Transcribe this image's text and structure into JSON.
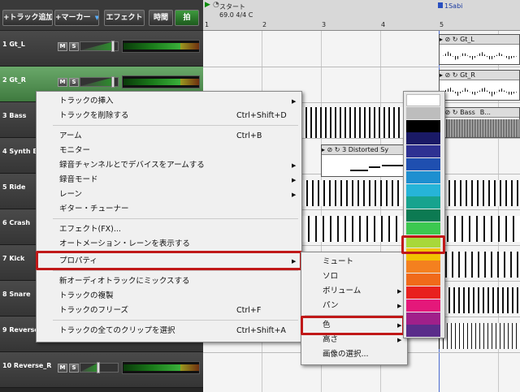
{
  "toolbar": {
    "add_track": "+トラック追加",
    "marker": "+マーカー",
    "effect": "エフェクト",
    "time": "時間",
    "beat": "拍"
  },
  "ruler": {
    "start_marker": "スタート",
    "tempo": "69.0 4/4 C",
    "sabi_marker": "1Sabi",
    "bars": [
      "1",
      "2",
      "3",
      "4",
      "5"
    ]
  },
  "tracks": [
    {
      "name": "1 Gt_L",
      "mute": "M",
      "solo": "S"
    },
    {
      "name": "2 Gt_R",
      "mute": "M",
      "solo": "S"
    },
    {
      "name": "3 Bass"
    },
    {
      "name": "4 Synth B"
    },
    {
      "name": "5 Ride"
    },
    {
      "name": "6 Crash"
    },
    {
      "name": "7 Kick"
    },
    {
      "name": "8 Snare"
    },
    {
      "name": "9 Reverse"
    },
    {
      "name": "10 Reverse_R",
      "mute": "M",
      "solo": "S"
    }
  ],
  "clips": {
    "gt_l": "Gt_L",
    "gt_r": "Gt_R",
    "bass": "Bass",
    "bass2": "B...",
    "synth": "3 Distorted Sy"
  },
  "context_menu": {
    "items": [
      {
        "label": "トラックの挿入",
        "shortcut": "",
        "submenu": true
      },
      {
        "label": "トラックを削除する",
        "shortcut": "Ctrl+Shift+D",
        "submenu": false
      },
      {
        "label": "アーム",
        "shortcut": "Ctrl+B",
        "submenu": false
      },
      {
        "label": "モニター",
        "shortcut": "",
        "submenu": false
      },
      {
        "label": "録音チャンネルとでデバイスをアームする",
        "shortcut": "",
        "submenu": true
      },
      {
        "label": "録音モード",
        "shortcut": "",
        "submenu": true
      },
      {
        "label": "レーン",
        "shortcut": "",
        "submenu": true
      },
      {
        "label": "ギター・チューナー",
        "shortcut": "",
        "submenu": false
      },
      {
        "label": "エフェクト(FX)...",
        "shortcut": "",
        "submenu": false
      },
      {
        "label": "オートメーション・レーンを表示する",
        "shortcut": "",
        "submenu": false
      },
      {
        "label": "プロパティ",
        "shortcut": "",
        "submenu": true
      },
      {
        "label": "新オーディオトラックにミックスする",
        "shortcut": "",
        "submenu": false
      },
      {
        "label": "トラックの複製",
        "shortcut": "",
        "submenu": false
      },
      {
        "label": "トラックのフリーズ",
        "shortcut": "Ctrl+F",
        "submenu": false
      },
      {
        "label": "トラックの全てのクリップを選択",
        "shortcut": "Ctrl+Shift+A",
        "submenu": false
      }
    ]
  },
  "properties_menu": {
    "items": [
      {
        "label": "ミュート",
        "submenu": false
      },
      {
        "label": "ソロ",
        "submenu": false
      },
      {
        "label": "ボリューム",
        "submenu": true
      },
      {
        "label": "パン",
        "submenu": true
      },
      {
        "label": "色",
        "submenu": true
      },
      {
        "label": "高さ",
        "submenu": true
      },
      {
        "label": "画像の選択...",
        "submenu": false
      }
    ]
  },
  "arrow_glyph": "▶",
  "color_palette": [
    "#ffffff",
    "#bdbdbd",
    "#000000",
    "#1a1a66",
    "#2e3192",
    "#1f4fb0",
    "#1e8fd0",
    "#26b4d8",
    "#17a38e",
    "#0c7a52",
    "#3cc850",
    "#a8d83a",
    "#f2c200",
    "#f4801f",
    "#f06a1a",
    "#e8201e",
    "#e4187a",
    "#a0208a",
    "#5a2d8a"
  ],
  "highlight_color": "#c01818"
}
